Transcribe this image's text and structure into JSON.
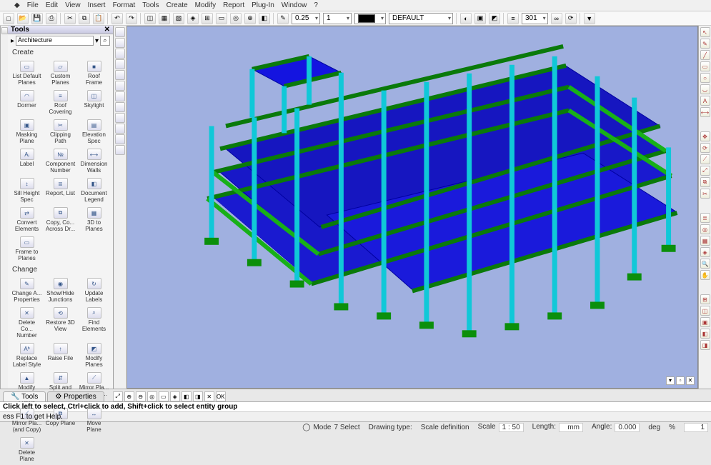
{
  "menu": {
    "items": [
      "File",
      "Edit",
      "View",
      "Insert",
      "Format",
      "Tools",
      "Create",
      "Modify",
      "Report",
      "Plug-In",
      "Window",
      "?"
    ]
  },
  "toolbar": {
    "thickness": "0.25",
    "lineStyle": "1",
    "colorLabel": "",
    "layer": "DEFAULT",
    "numField": "301"
  },
  "panel": {
    "title": "Tools",
    "category": "Architecture",
    "searchIcon": "⌕",
    "sections": {
      "create": {
        "label": "Create",
        "items": [
          {
            "ic": "▭",
            "lb": "List Default Planes"
          },
          {
            "ic": "▱",
            "lb": "Custom Planes"
          },
          {
            "ic": "■",
            "lb": "Roof Frame"
          },
          {
            "ic": "◠",
            "lb": "Dormer"
          },
          {
            "ic": "≡",
            "lb": "Roof Covering"
          },
          {
            "ic": "◫",
            "lb": "Skylight"
          },
          {
            "ic": "▣",
            "lb": "Masking Plane"
          },
          {
            "ic": "✂",
            "lb": "Clipping Path"
          },
          {
            "ic": "▤",
            "lb": "Elevation Spec"
          },
          {
            "ic": "Aᵢ",
            "lb": "Label"
          },
          {
            "ic": "№",
            "lb": "Component Number"
          },
          {
            "ic": "⟷",
            "lb": "Dimension Walls"
          },
          {
            "ic": "↕",
            "lb": "Sill Height Spec"
          },
          {
            "ic": "≣",
            "lb": "Report, List"
          },
          {
            "ic": "◧",
            "lb": "Document Legend"
          },
          {
            "ic": "⇄",
            "lb": "Convert Elements"
          },
          {
            "ic": "⧉",
            "lb": "Copy, Co... Across Dr..."
          },
          {
            "ic": "▦",
            "lb": "3D to Planes"
          },
          {
            "ic": "▭",
            "lb": "Frame to Planes"
          }
        ]
      },
      "change": {
        "label": "Change",
        "items": [
          {
            "ic": "✎",
            "lb": "Change A... Properties"
          },
          {
            "ic": "◉",
            "lb": "Show/Hide Junctions"
          },
          {
            "ic": "↻",
            "lb": "Update Labels"
          },
          {
            "ic": "✕",
            "lb": "Delete Co... Number"
          },
          {
            "ic": "⟲",
            "lb": "Restore 3D View"
          },
          {
            "ic": "⌕",
            "lb": "Find Elements"
          },
          {
            "ic": "Aᵇ",
            "lb": "Replace Label Style"
          },
          {
            "ic": "↑",
            "lb": "Raise File"
          },
          {
            "ic": "◩",
            "lb": "Modify Planes"
          },
          {
            "ic": "▲",
            "lb": "Modify Roof Frame"
          },
          {
            "ic": "⇵",
            "lb": "Split and Lower"
          },
          {
            "ic": "⟋",
            "lb": "Mirror Pla... (without ..."
          },
          {
            "ic": "⟋",
            "lb": "Mirror Pla... (and Copy)"
          },
          {
            "ic": "⧉",
            "lb": "Copy Plane"
          },
          {
            "ic": "↔",
            "lb": "Move Plane"
          },
          {
            "ic": "✕",
            "lb": "Delete Plane"
          }
        ]
      }
    }
  },
  "tabs": {
    "tools": "Tools",
    "properties": "Properties"
  },
  "viewButtons": [
    "⤢",
    "⊕",
    "⊖",
    "◎",
    "▭",
    "◈",
    "◧",
    "◨",
    "✕",
    "OK"
  ],
  "hints": {
    "h1": "Click left to select, Ctrl+click to add, Shift+click to select entity group",
    "h2": "ess F1 to get Help."
  },
  "status": {
    "modeLbl": "Mode",
    "mode": "7 Select",
    "drawLbl": "Drawing type:",
    "draw": "",
    "scaleDefLbl": "Scale definition",
    "scaleDef": "",
    "scaleLbl": "Scale",
    "scale": "1 : 50",
    "lenLbl": "Length:",
    "len": "mm",
    "angLbl": "Angle:",
    "ang": "0.000",
    "unitLbl": "deg",
    "pct": "%",
    "pctVal": "1"
  }
}
